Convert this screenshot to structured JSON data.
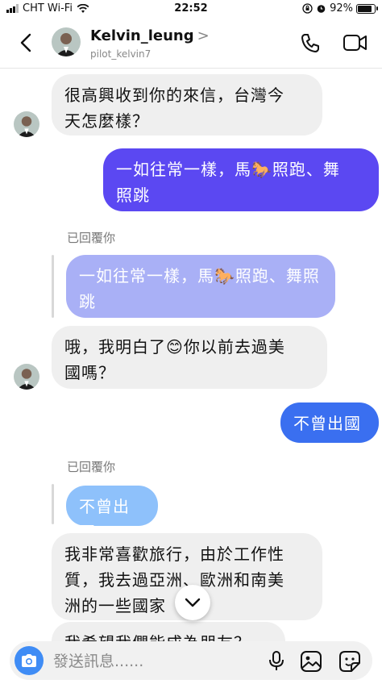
{
  "status_bar": {
    "carrier": "CHT Wi-Fi",
    "time": "22:52",
    "battery": "92%",
    "battery_level": 0.92
  },
  "header": {
    "username": "Kelvin_leung",
    "chevron": ">",
    "handle": "pilot_kelvin7"
  },
  "messages": [
    {
      "type": "received",
      "lines": [
        "很高興收到你的來信，台灣今",
        "天怎麼樣？"
      ]
    },
    {
      "type": "sent",
      "lines": [
        "一如往常一樣，馬🐎照跑、舞",
        "照跳"
      ]
    },
    {
      "type": "replied_label",
      "text": "已回覆你"
    },
    {
      "type": "reply_quote",
      "lines": [
        "一如往常一樣，馬🐎照跑、舞照",
        "跳"
      ]
    },
    {
      "type": "received",
      "lines": [
        "哦，我明白了😊你以前去過美",
        "國嗎？"
      ]
    },
    {
      "type": "sent",
      "lines": [
        "不曾出國"
      ]
    },
    {
      "type": "replied_label",
      "text": "已回覆你"
    },
    {
      "type": "reply_quote",
      "lines": [
        "不曾出國"
      ]
    },
    {
      "type": "received",
      "lines": [
        "我非常喜歡旅行，由於工作性",
        "質，我去過亞洲、歐洲和南美",
        "洲的一些國家"
      ]
    },
    {
      "type": "received",
      "lines": [
        "我希望我們能成為朋友？"
      ]
    }
  ],
  "composer": {
    "placeholder": "發送訊息......"
  }
}
